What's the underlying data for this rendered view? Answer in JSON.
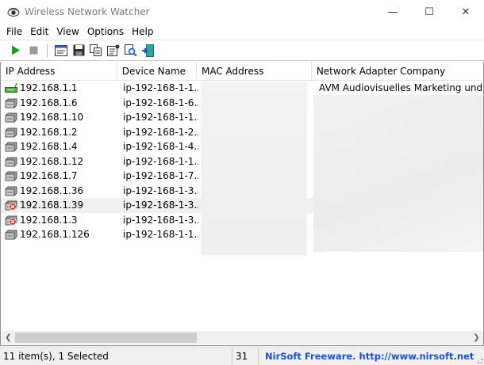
{
  "window": {
    "title": "Wireless Network Watcher",
    "controls": {
      "minimize": "—",
      "maximize": "☐",
      "close": "✕"
    }
  },
  "menu": [
    "File",
    "Edit",
    "View",
    "Options",
    "Help"
  ],
  "toolbar": {
    "buttons": [
      "start-scan",
      "stop-scan",
      "html-report",
      "save",
      "copy",
      "properties",
      "find",
      "exit"
    ]
  },
  "columns": [
    "IP Address",
    "Device Name",
    "MAC Address",
    "Network Adapter Company"
  ],
  "rows": [
    {
      "ip": "192.168.1.1",
      "device": "ip-192-168-1-1....",
      "mac": "",
      "company": "AVM Audiovisuelles Marketing und Com",
      "icon": "router-icon"
    },
    {
      "ip": "192.168.1.6",
      "device": "ip-192-168-1-6....",
      "mac": "",
      "company": "",
      "icon": "device-icon"
    },
    {
      "ip": "192.168.1.10",
      "device": "ip-192-168-1-1....",
      "mac": "",
      "company": "",
      "icon": "device-icon"
    },
    {
      "ip": "192.168.1.2",
      "device": "ip-192-168-1-2....",
      "mac": "",
      "company": "",
      "icon": "device-icon"
    },
    {
      "ip": "192.168.1.4",
      "device": "ip-192-168-1-4....",
      "mac": "",
      "company": "",
      "icon": "device-icon"
    },
    {
      "ip": "192.168.1.12",
      "device": "ip-192-168-1-1....",
      "mac": "",
      "company": "",
      "icon": "device-icon"
    },
    {
      "ip": "192.168.1.7",
      "device": "ip-192-168-1-7....",
      "mac": "",
      "company": "",
      "icon": "device-icon"
    },
    {
      "ip": "192.168.1.36",
      "device": "ip-192-168-1-3....",
      "mac": "",
      "company": "",
      "icon": "device-icon"
    },
    {
      "ip": "192.168.1.39",
      "device": "ip-192-168-1-3....",
      "mac": "",
      "company": "",
      "icon": "offline-computer-icon",
      "selected": true
    },
    {
      "ip": "192.168.1.3",
      "device": "ip-192-168-1-3....",
      "mac": "",
      "company": "",
      "icon": "offline-device-icon"
    },
    {
      "ip": "192.168.1.126",
      "device": "ip-192-168-1-1....",
      "mac": "",
      "company": "",
      "icon": "device-icon"
    }
  ],
  "scrollbar": {
    "left_arrow": "❮",
    "right_arrow": "❯",
    "thumb_fraction": 0.4
  },
  "status": {
    "items": "11 item(s), 1 Selected",
    "count": "31",
    "credit": "NirSoft Freeware.  http://www.nirsoft.net"
  },
  "colors": {
    "accent_link": "#1b4fd8",
    "selected_row": "#f0f0f0",
    "play_green": "#14a014"
  }
}
